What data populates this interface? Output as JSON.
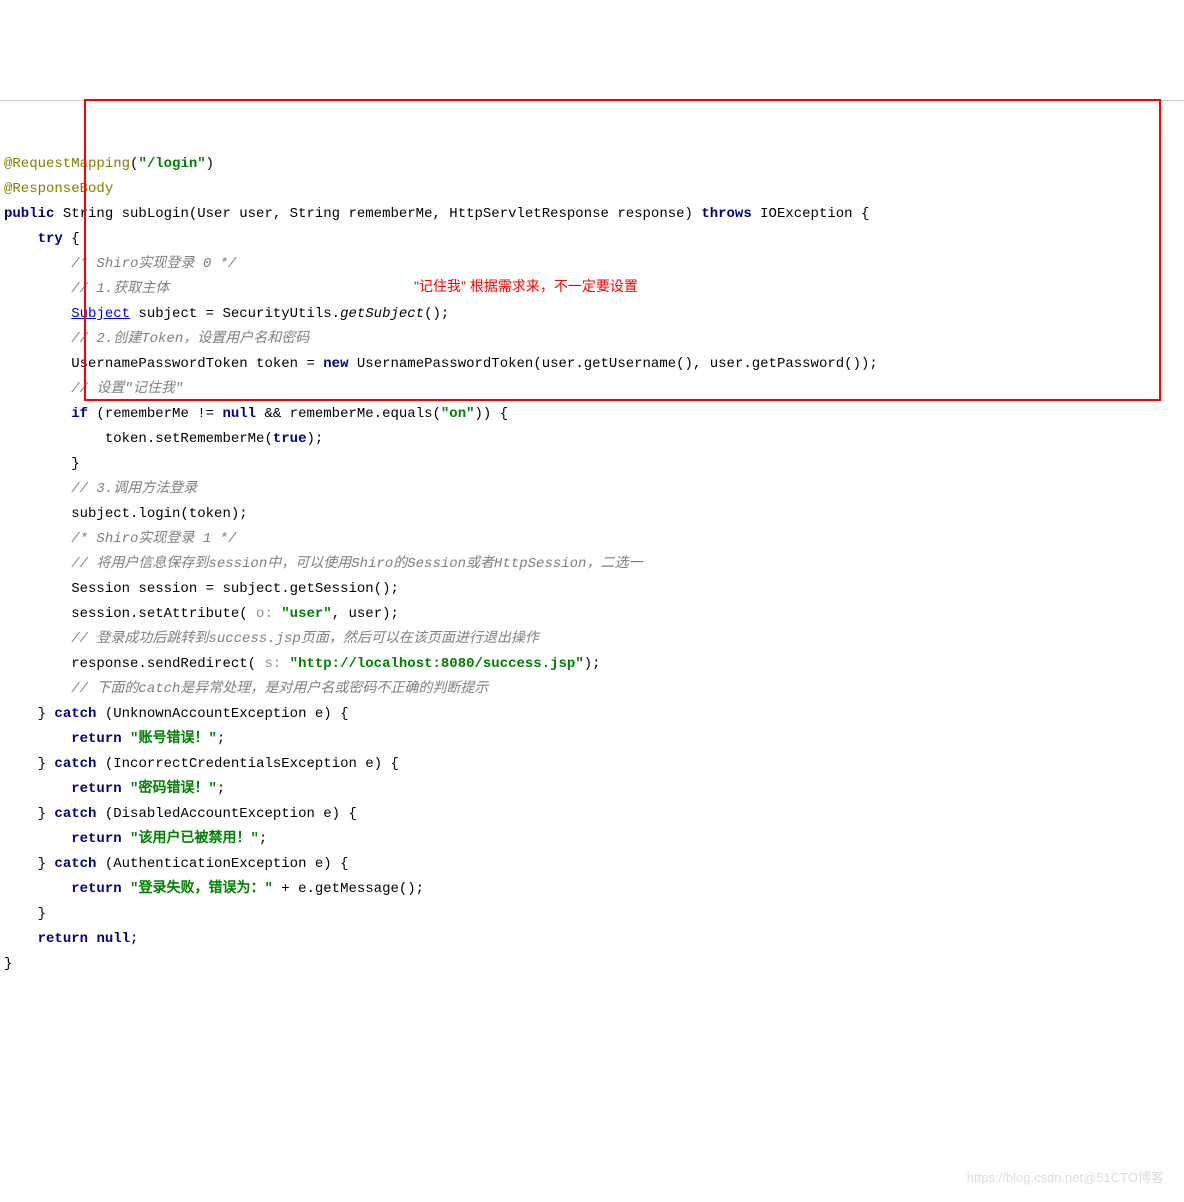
{
  "code": {
    "annotation_request_mapping": "@RequestMapping",
    "annotation_request_mapping_value": "(\"/login\")",
    "request_mapping_url": "\"/login\"",
    "annotation_response_body": "@ResponseBody",
    "public": "public",
    "string_type": "String",
    "method_name": "subLogin",
    "params": "(User user, String rememberMe, HttpServletResponse response)",
    "throws": "throws",
    "exception_type": "IOException",
    "try": "try",
    "comment_shiro_start": "/* Shiro实现登录 0 */",
    "comment_get_subject": "// 1.获取主体",
    "subject_type": "Subject",
    "subject_line": " subject = SecurityUtils.",
    "get_subject": "getSubject",
    "subject_end": "();",
    "comment_create_token": "// 2.创建Token，设置用户名和密码",
    "token_line_start": "UsernamePasswordToken token = ",
    "new": "new",
    "token_line_end": " UsernamePasswordToken(user.getUsername(), user.getPassword());",
    "comment_remember_me": "// 设置\"记住我\"",
    "if": "if",
    "remember_cond_start": " (rememberMe != ",
    "null": "null",
    "remember_cond_mid": " && rememberMe.equals(",
    "on_str": "\"on\"",
    "remember_cond_end": ")) {",
    "set_remember_line": "    token.setRememberMe(",
    "true": "true",
    "set_remember_end": ");",
    "close_brace": "}",
    "comment_login": "// 3.调用方法登录",
    "login_line": "subject.login(token);",
    "comment_shiro_end": "/* Shiro实现登录 1 */",
    "comment_session": "// 将用户信息保存到session中，可以使用Shiro的Session或者HttpSession，二选一",
    "session_line": "Session session = subject.getSession();",
    "set_attr_start": "session.setAttribute(",
    "hint_o": " o: ",
    "user_str": "\"user\"",
    "set_attr_end": ", user);",
    "comment_redirect": "// 登录成功后跳转到success.jsp页面，然后可以在该页面进行退出操作",
    "redirect_start": "response.sendRedirect(",
    "hint_s": " s: ",
    "url_str": "\"http://localhost:8080/success.jsp\"",
    "redirect_end": ");",
    "comment_catch": "// 下面的catch是异常处理，是对用户名或密码不正确的判断提示",
    "catch": "catch",
    "catch1_ex": "(UnknownAccountException e) {",
    "return": "return",
    "return1_str": "\"账号错误！\"",
    "semicolon": ";",
    "catch2_ex": "(IncorrectCredentialsException e) {",
    "return2_str": "\"密码错误！\"",
    "catch3_ex": "(DisabledAccountException e) {",
    "return3_str": "\"该用户已被禁用！\"",
    "catch4_ex": "(AuthenticationException e) {",
    "return4_start": "\"登录失败，错误为：\"",
    "return4_end": " + e.getMessage();",
    "return_null": "return null;"
  },
  "red_annotation": "\"记住我\" 根据需求来，不一定要设置",
  "watermark": "https://blog.csdn.net@51CTO博客"
}
